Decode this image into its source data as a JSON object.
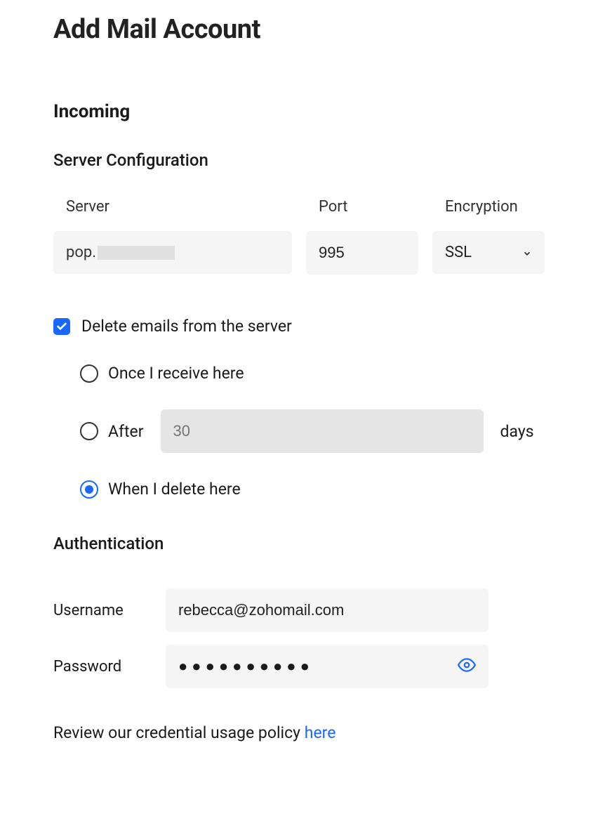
{
  "page_title": "Add Mail Account",
  "incoming": {
    "heading": "Incoming",
    "server_config": {
      "heading": "Server Configuration",
      "server_label": "Server",
      "server_value_prefix": "pop.",
      "port_label": "Port",
      "port_value": "995",
      "encryption_label": "Encryption",
      "encryption_value": "SSL"
    },
    "delete_option": {
      "checkbox_label": "Delete emails from the server",
      "checked": true,
      "radio_once": "Once I receive here",
      "radio_after_prefix": "After",
      "radio_after_days_placeholder": "30",
      "radio_after_suffix": "days",
      "radio_when_delete": "When I delete here",
      "selected_radio": "when_delete"
    },
    "authentication": {
      "heading": "Authentication",
      "username_label": "Username",
      "username_value": "rebecca@zohomail.com",
      "password_label": "Password",
      "password_masked": "●●●●●●●●●●"
    }
  },
  "policy": {
    "text": "Review our credential usage policy ",
    "link_text": "here"
  }
}
